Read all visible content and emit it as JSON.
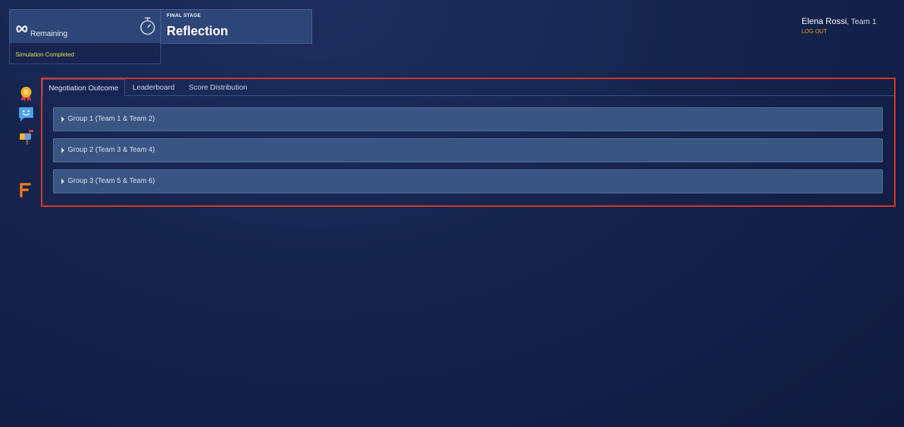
{
  "timer": {
    "remaining_label": "Remaining",
    "infinity_icon": "infinity-icon",
    "stopwatch_icon": "stopwatch-icon"
  },
  "status": {
    "text": "Simulation Completed",
    "color": "#d7e85a"
  },
  "stage": {
    "label": "FINAL STAGE",
    "name": "Reflection"
  },
  "user": {
    "name": "Elena Rossi",
    "team": ", Team 1",
    "logout": "LOG OUT"
  },
  "sidebar": {
    "icons": [
      "award-ribbon-icon",
      "chat-smiley-icon",
      "mailbox-icon",
      "brand-f-logo-icon"
    ]
  },
  "tabs": [
    {
      "label": "Negotiation Outcome",
      "active": true
    },
    {
      "label": "Leaderboard",
      "active": false
    },
    {
      "label": "Score Distribution",
      "active": false
    }
  ],
  "groups": [
    {
      "label": "Group 1 (Team 1 & Team 2)"
    },
    {
      "label": "Group 2 (Team 3 & Team 4)"
    },
    {
      "label": "Group 3 (Team 5 & Team 6)"
    }
  ],
  "colors": {
    "accent_orange": "#f0a12a",
    "highlight_border": "#e5391f",
    "panel_blue": "#2e4677"
  }
}
